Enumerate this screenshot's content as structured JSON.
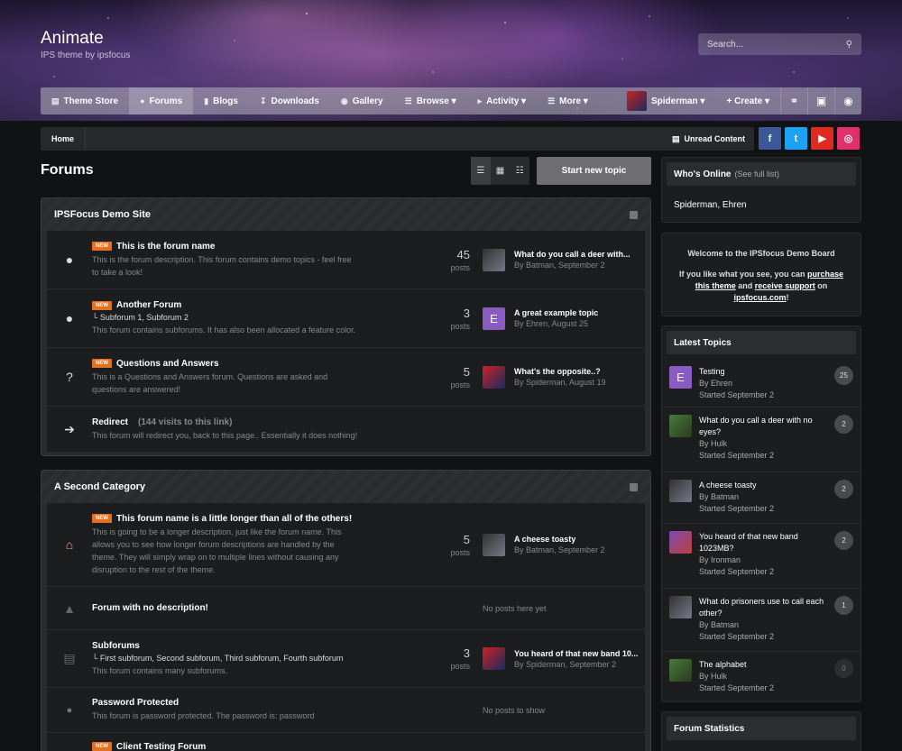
{
  "brand": {
    "title": "Animate",
    "subtitle": "IPS theme by ipsfocus"
  },
  "search": {
    "placeholder": "Search..."
  },
  "nav": {
    "items": [
      {
        "label": "Theme Store",
        "icon": "document-icon"
      },
      {
        "label": "Forums",
        "icon": "chat-icon",
        "active": true
      },
      {
        "label": "Blogs",
        "icon": "book-icon"
      },
      {
        "label": "Downloads",
        "icon": "download-icon"
      },
      {
        "label": "Gallery",
        "icon": "camera-icon"
      },
      {
        "label": "Browse ▾",
        "icon": "list-icon"
      },
      {
        "label": "Activity ▾",
        "icon": "megaphone-icon"
      },
      {
        "label": "More ▾",
        "icon": "menu-icon"
      }
    ],
    "user": "Spiderman ▾",
    "create": "+ Create ▾"
  },
  "breadcrumb": {
    "home": "Home",
    "unread": "Unread Content"
  },
  "social": [
    {
      "icon": "facebook-icon",
      "glyph": "f",
      "color": "#3b5998"
    },
    {
      "icon": "twitter-icon",
      "glyph": "t",
      "color": "#1da1f2"
    },
    {
      "icon": "youtube-icon",
      "glyph": "▶",
      "color": "#e02a20"
    },
    {
      "icon": "instagram-icon",
      "glyph": "◎",
      "color": "#e1306c"
    }
  ],
  "page": {
    "title": "Forums",
    "start_topic": "Start new topic"
  },
  "categories": [
    {
      "title": "IPSFocus Demo Site",
      "forums": [
        {
          "new": "NEW",
          "title": "This is the forum name",
          "desc1": "This is the forum description. This forum contains demo topics - feel free",
          "desc2": "to take a look!",
          "posts": "45",
          "posts_label": "posts",
          "last_title": "What do you call a deer with...",
          "last_by": "By Batman, September 2"
        },
        {
          "new": "NEW",
          "title": "Another Forum",
          "sub": "└ Subforum 1,  Subforum 2",
          "desc1": "This forum contains subforums. It has also been allocated a feature color.",
          "posts": "3",
          "posts_label": "posts",
          "last_avatar": "E",
          "last_title": "A great example topic",
          "last_by": "By Ehren, August 25"
        },
        {
          "new": "NEW",
          "title": "Questions and Answers",
          "desc1": "This is a Questions and Answers forum. Questions are asked and",
          "desc2": "questions are answered!",
          "posts": "5",
          "posts_label": "posts",
          "last_title": "What's the opposite..?",
          "last_by": "By Spiderman, August 19"
        },
        {
          "title": "Redirect",
          "redirect_count": "(144 visits to this link)",
          "desc1": "This forum will redirect you, back to this page.. Essentially it does nothing!"
        }
      ]
    },
    {
      "title": "A Second Category",
      "forums": [
        {
          "new": "NEW",
          "title": "This forum name is a little longer than all of the others!",
          "desc1": "This is going to be a longer description, just like the forum name. This",
          "desc2": "allows you to see how longer forum descriptions are handled by the",
          "desc3": "theme. They will simply wrap on to multiple lines without causing any",
          "desc4": "disruption to the rest of the theme.",
          "posts": "5",
          "posts_label": "posts",
          "last_title": "A cheese toasty",
          "last_by": "By Batman, September 2"
        },
        {
          "title": "Forum with no description!",
          "no_posts": "No posts here yet"
        },
        {
          "title": "Subforums",
          "sub": "└ First subforum,  Second subforum,  Third subforum,  Fourth subforum",
          "desc1": "This forum contains many subforums.",
          "posts": "3",
          "posts_label": "posts",
          "last_title": "You heard of that new band 10...",
          "last_by": "By Spiderman, September 2"
        },
        {
          "title": "Password Protected",
          "desc1": "This forum is password protected. The password is: password",
          "no_posts": "No posts to show"
        },
        {
          "new": "NEW",
          "title": "Client Testing Forum"
        }
      ]
    }
  ],
  "sidebar": {
    "online": {
      "title": "Who's Online",
      "sub": "(See full list)",
      "users": "Spiderman, Ehren"
    },
    "welcome": {
      "line1": "Welcome to the IPSfocus Demo Board",
      "line2a": "If you like what you see, you can ",
      "purchase": "purchase",
      "line3a": "this theme",
      "line3b": " and ",
      "support": "receive support",
      "line3c": " on",
      "site": "ipsfocus.com",
      "bang": "!"
    },
    "latest": {
      "title": "Latest Topics",
      "topics": [
        {
          "avatar": "E",
          "title": "Testing",
          "by": "By Ehren",
          "started": "Started September 2",
          "count": "25"
        },
        {
          "title": "What do you call a deer with no eyes?",
          "by": "By Hulk",
          "started": "Started September 2",
          "count": "2"
        },
        {
          "title": "A cheese toasty",
          "by": "By Batman",
          "started": "Started September 2",
          "count": "2"
        },
        {
          "title": "You heard of that new band 1023MB?",
          "by": "By Ironman",
          "started": "Started September 2",
          "count": "2"
        },
        {
          "title": "What do prisoners use to call each other?",
          "by": "By Batman",
          "started": "Started September 2",
          "count": "1"
        },
        {
          "title": "The alphabet",
          "by": "By Hulk",
          "started": "Started September 2",
          "count": "0"
        }
      ]
    },
    "stats": {
      "title": "Forum Statistics"
    }
  }
}
